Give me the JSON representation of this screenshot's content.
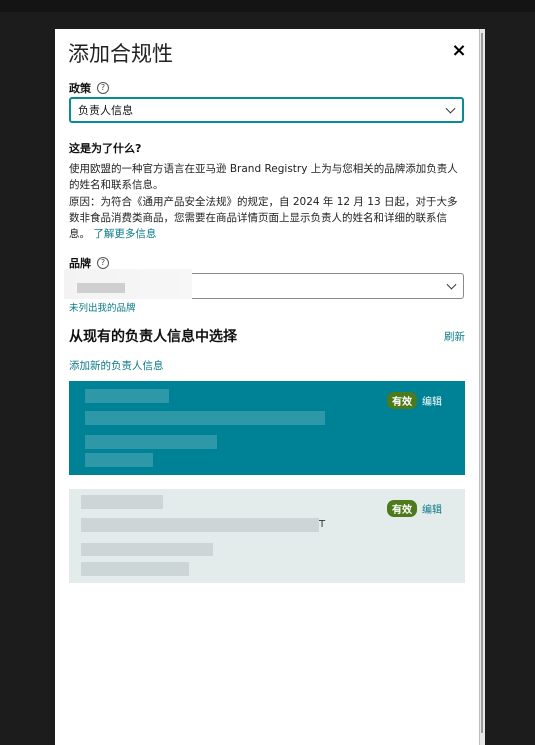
{
  "dialog": {
    "title": "添加合规性",
    "close_label": "×"
  },
  "policy": {
    "label": "政策",
    "help_icon": "?",
    "selected_value": "负责人信息"
  },
  "why": {
    "heading": "这是为了什么?",
    "text": "使用欧盟的一种官方语言在亚马逊 Brand Registry 上为与您相关的品牌添加负责人的姓名和联系信息。",
    "reason": "原因：为符合《通用产品安全法规》的规定，自 2024 年 12 月 13 日起，对于大多数非食品消费类商品，您需要在商品详情页面上显示负责人的姓名和详细的联系信息。",
    "learn_more": "了解更多信息"
  },
  "brand": {
    "label": "品牌",
    "help_icon": "?",
    "not_listed_link": "未列出我的品牌"
  },
  "existing": {
    "heading": "从现有的负责人信息中选择",
    "refresh": "刷新",
    "add_new": "添加新的负责人信息"
  },
  "cards": [
    {
      "status": "有效",
      "edit": "编辑",
      "state": "selected"
    },
    {
      "status": "有效",
      "edit": "编辑",
      "state": "normal",
      "visible_fragment": "T"
    }
  ],
  "colors": {
    "accent": "#008296",
    "link": "#0a7a87",
    "badge": "#4d7a1a",
    "card_alt": "#e3ebeb",
    "backdrop": "#1c1c1c"
  },
  "icons": {
    "close": "close-icon",
    "help": "help-icon",
    "dropdown": "chevron-down-icon"
  }
}
